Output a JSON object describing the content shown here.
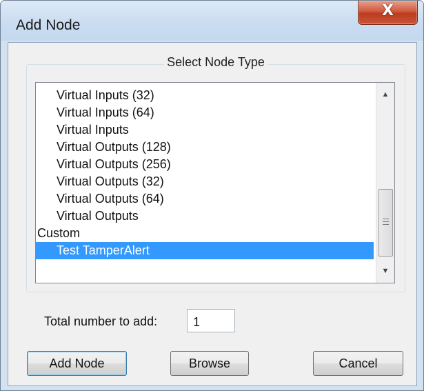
{
  "window": {
    "title": "Add Node",
    "close_symbol": "X"
  },
  "group": {
    "title": "Select Node Type"
  },
  "list": {
    "items": [
      {
        "label": "Virtual Inputs (32)",
        "kind": "item"
      },
      {
        "label": "Virtual Inputs (64)",
        "kind": "item"
      },
      {
        "label": "Virtual Inputs",
        "kind": "item"
      },
      {
        "label": "Virtual Outputs (128)",
        "kind": "item"
      },
      {
        "label": "Virtual Outputs (256)",
        "kind": "item"
      },
      {
        "label": "Virtual Outputs (32)",
        "kind": "item"
      },
      {
        "label": "Virtual Outputs (64)",
        "kind": "item"
      },
      {
        "label": "Virtual Outputs",
        "kind": "item"
      },
      {
        "label": "Custom",
        "kind": "category"
      },
      {
        "label": "Test TamperAlert",
        "kind": "item",
        "selected": true
      }
    ],
    "selected_color": "#3399ff",
    "scroll_up_icon": "arrow-up",
    "scroll_down_icon": "arrow-down"
  },
  "count": {
    "label": "Total number to add:",
    "value": "1"
  },
  "buttons": {
    "add": "Add Node",
    "browse": "Browse",
    "cancel": "Cancel"
  },
  "colors": {
    "close_button": "#c9553a",
    "frame": "#d3e2f1",
    "dialog_bg": "#f0f0f0"
  }
}
